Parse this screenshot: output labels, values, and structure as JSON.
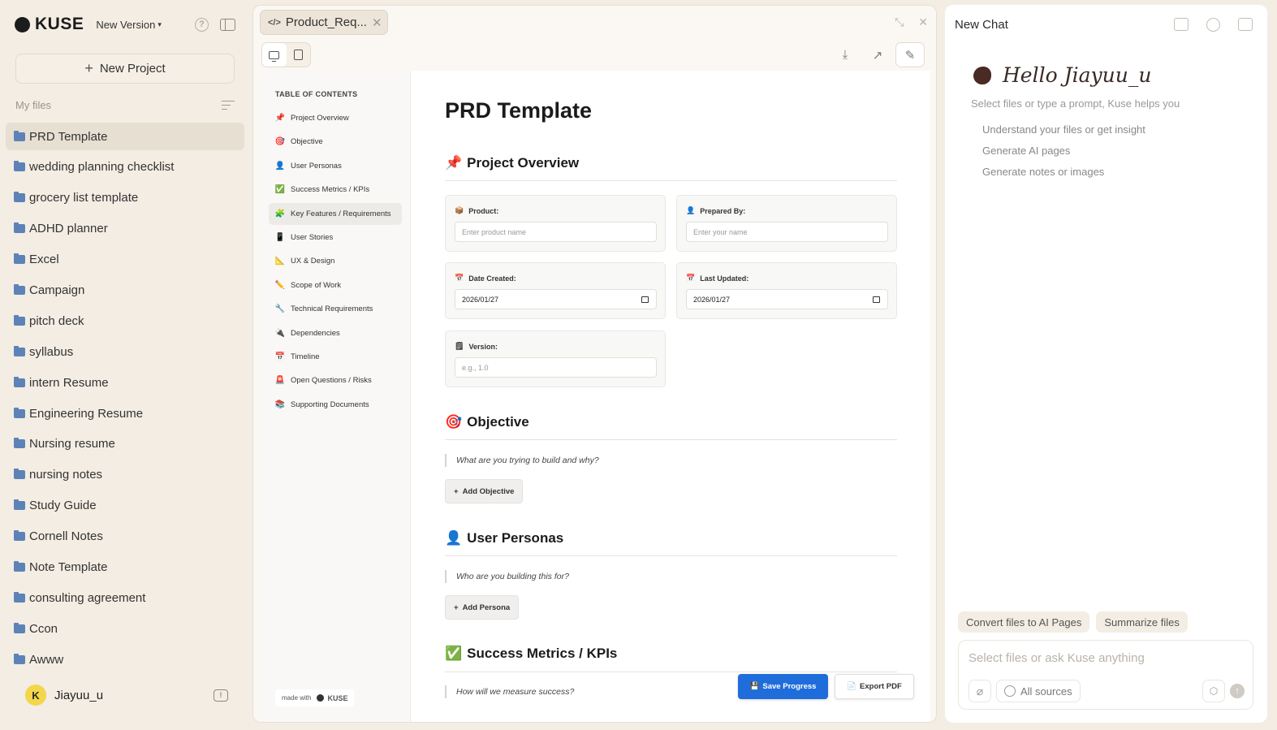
{
  "app": {
    "brand": "KUSE",
    "version_label": "New Version"
  },
  "sidebar": {
    "new_project_label": "New Project",
    "my_files_label": "My files",
    "files": [
      "PRD Template",
      "wedding planning checklist",
      "grocery list template",
      "ADHD planner",
      "Excel",
      "Campaign",
      "pitch deck",
      "syllabus",
      "intern Resume",
      "Engineering Resume",
      "Nursing resume",
      "nursing notes",
      "Study Guide",
      "Cornell Notes",
      "Note Template",
      "consulting agreement",
      "Ccon",
      "Awww"
    ],
    "active_file": "PRD Template",
    "user": {
      "initial": "K",
      "name": "Jiayuu_u"
    }
  },
  "editor": {
    "tab_title": "Product_Req...",
    "toc": {
      "title": "TABLE OF CONTENTS",
      "items": [
        {
          "emoji": "📌",
          "label": "Project Overview"
        },
        {
          "emoji": "🎯",
          "label": "Objective"
        },
        {
          "emoji": "👤",
          "label": "User Personas"
        },
        {
          "emoji": "✅",
          "label": "Success Metrics / KPIs"
        },
        {
          "emoji": "🧩",
          "label": "Key Features / Requirements"
        },
        {
          "emoji": "📱",
          "label": "User Stories"
        },
        {
          "emoji": "📐",
          "label": "UX & Design"
        },
        {
          "emoji": "✏️",
          "label": "Scope of Work"
        },
        {
          "emoji": "🔧",
          "label": "Technical Requirements"
        },
        {
          "emoji": "🔌",
          "label": "Dependencies"
        },
        {
          "emoji": "📅",
          "label": "Timeline"
        },
        {
          "emoji": "🚨",
          "label": "Open Questions / Risks"
        },
        {
          "emoji": "📚",
          "label": "Supporting Documents"
        }
      ],
      "active_index": 4
    },
    "made_with": "made with",
    "made_with_brand": "KUSE",
    "doc": {
      "title": "PRD Template",
      "overview": {
        "heading": "Project Overview",
        "emoji": "📌",
        "product_label": "Product:",
        "product_placeholder": "Enter product name",
        "prepared_label": "Prepared By:",
        "prepared_placeholder": "Enter your name",
        "created_label": "Date Created:",
        "created_value": "2026/01/27",
        "updated_label": "Last Updated:",
        "updated_value": "2026/01/27",
        "version_label": "Version:",
        "version_placeholder": "e.g., 1.0"
      },
      "objective": {
        "heading": "Objective",
        "emoji": "🎯",
        "prompt": "What are you trying to build and why?",
        "button": "Add Objective"
      },
      "personas": {
        "heading": "User Personas",
        "emoji": "👤",
        "prompt": "Who are you building this for?",
        "button": "Add Persona"
      },
      "metrics": {
        "heading": "Success Metrics / KPIs",
        "emoji": "✅",
        "prompt": "How will we measure success?"
      }
    },
    "save_label": "Save Progress",
    "export_label": "Export PDF"
  },
  "chat": {
    "title": "New Chat",
    "greeting": "Hello Jiayuu_u",
    "subtitle": "Select files or type a prompt, Kuse helps you",
    "options": [
      "Understand your files or get insight",
      "Generate AI pages",
      "Generate notes or images"
    ],
    "chips": [
      "Convert files to AI Pages",
      "Summarize files"
    ],
    "input_placeholder": "Select files or ask Kuse anything",
    "sources_label": "All sources"
  },
  "colors": {
    "accent": "#1f6ddb",
    "folder": "#5d82b8",
    "background": "#f3ede4"
  }
}
